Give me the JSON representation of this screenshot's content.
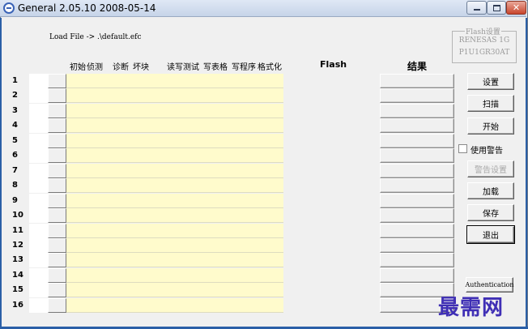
{
  "window": {
    "title": "General 2.05.10 2008-05-14"
  },
  "load_file_label": "Load File -> .\\default.efc",
  "columns": {
    "initial": "初始",
    "blank": "侦测",
    "diagnose": "诊断",
    "bad_block": "坏块",
    "read_write_test": "读写测试",
    "write_table": "写表格",
    "write_program": "写程序",
    "format": "格式化",
    "flash": "Flash",
    "result": "结果"
  },
  "rows": [
    "1",
    "2",
    "3",
    "4",
    "5",
    "6",
    "7",
    "8",
    "9",
    "10",
    "11",
    "12",
    "13",
    "14",
    "15",
    "16"
  ],
  "flash_group": {
    "title": "Flash设置",
    "line1": "RENESAS 1G",
    "line2": "P1U1GR30AT"
  },
  "buttons": {
    "settings": "设置",
    "scan": "扫描",
    "start": "开始",
    "use_warning": "使用警告",
    "warning_settings": "警告设置",
    "load": "加载",
    "save": "保存",
    "exit": "退出",
    "authentication": "Authentication"
  },
  "watermark": "最需网",
  "colors": {
    "data_cell": "#fffbcc",
    "window_border": "#2b5fa7",
    "watermark": "#3f2fb5"
  }
}
